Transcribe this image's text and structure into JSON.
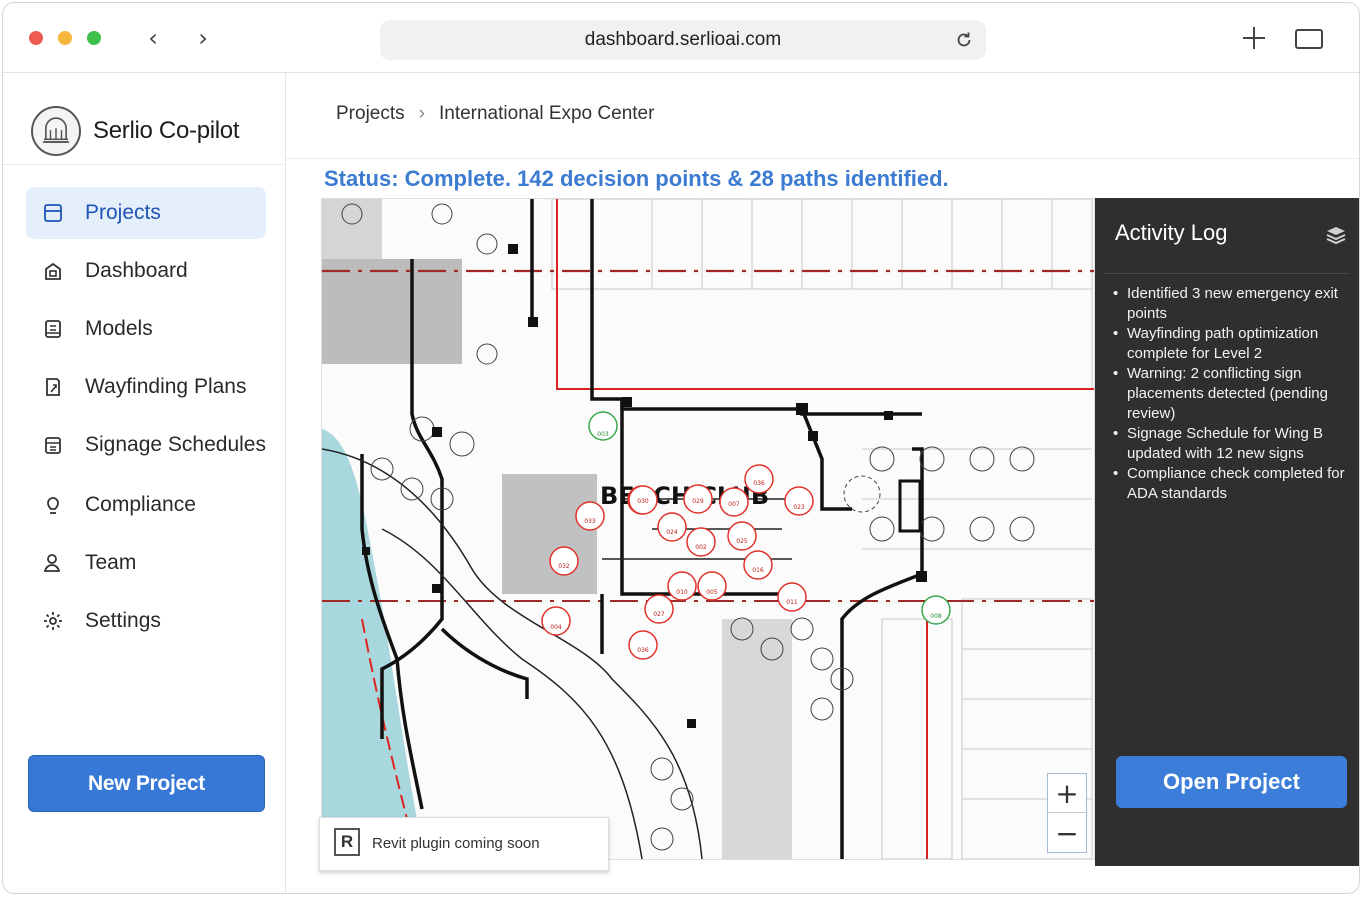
{
  "browser": {
    "url": "dashboard.serlioai.com"
  },
  "sidebar": {
    "brand": "Serlio Co-pilot",
    "items": [
      {
        "label": "Projects",
        "icon": "folder-icon",
        "active": true
      },
      {
        "label": "Dashboard",
        "icon": "home-icon",
        "active": false
      },
      {
        "label": "Models",
        "icon": "models-icon",
        "active": false
      },
      {
        "label": "Wayfinding Plans",
        "icon": "wayfinding-icon",
        "active": false
      },
      {
        "label": "Signage Schedules",
        "icon": "signage-icon",
        "active": false
      },
      {
        "label": "Compliance",
        "icon": "compliance-icon",
        "active": false
      },
      {
        "label": "Team",
        "icon": "team-icon",
        "active": false
      },
      {
        "label": "Settings",
        "icon": "gear-icon",
        "active": false
      }
    ],
    "new_project_label": "New Project"
  },
  "breadcrumb": {
    "root": "Projects",
    "current": "International Expo Center"
  },
  "status": "Status: Complete. 142 decision points & 28 paths identified.",
  "map": {
    "building_label": "BEACH CLUB",
    "markers": [
      "036",
      "035",
      "030",
      "029",
      "007",
      "023",
      "033",
      "024",
      "025",
      "002",
      "016",
      "010",
      "005",
      "011",
      "027",
      "004",
      "036",
      "032"
    ],
    "exits": [
      "003",
      "008"
    ],
    "zoom_in": "+",
    "zoom_out": "−",
    "revit_notice": "Revit plugin coming soon",
    "revit_icon_letter": "R"
  },
  "activity": {
    "title": "Activity Log",
    "entries": [
      "Identified 3 new emergency exit points",
      "Wayfinding path optimization complete for Level 2",
      "Warning: 2 conflicting sign placements detected (pending review)",
      "Signage Schedule for Wing B updated with 12 new signs",
      "Compliance check completed for ADA standards"
    ],
    "open_project_label": "Open Project"
  },
  "colors": {
    "accent": "#3778d6",
    "status_text": "#3b7bd1",
    "active_nav_bg": "#e5eefb",
    "panel_bg": "#2f2f30",
    "marker_red": "#e0322b",
    "exit_green": "#3aa84a"
  }
}
